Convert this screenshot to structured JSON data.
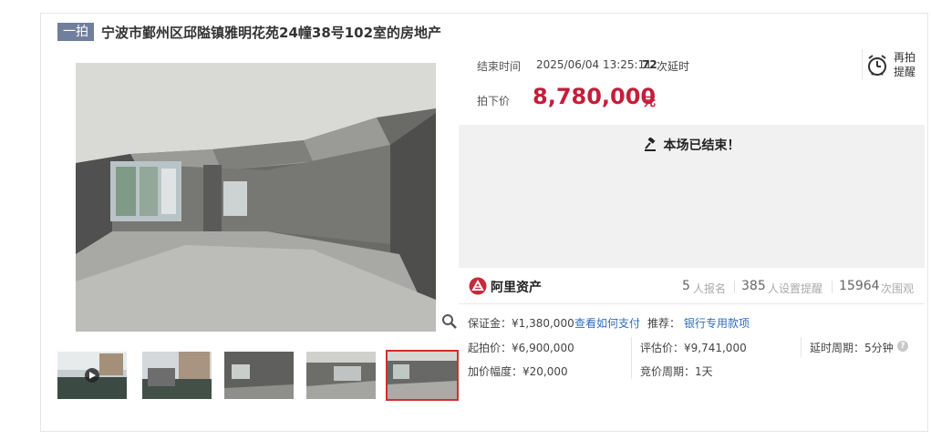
{
  "header": {
    "badge": "一拍",
    "title": "宁波市鄞州区邱隘镇雅明花苑24幢38号102室的房地产"
  },
  "auction": {
    "end_time_label": "结束时间",
    "end_time_value": "2025/06/04 13:25:11",
    "extend_count": "72",
    "extend_label": "次延时",
    "remind_line1": "再拍",
    "remind_line2": "提醒",
    "deal_price_label": "拍下价",
    "deal_price": "8,780,000",
    "currency": "元",
    "ended_text": "本场已结束！"
  },
  "platform": {
    "name": "阿里资产"
  },
  "stats": {
    "signups": "5",
    "signups_label": "人报名",
    "reminders": "385",
    "reminders_label": "人设置提醒",
    "views": "15964",
    "views_label": "次围观"
  },
  "details": {
    "deposit": "保证金：¥1,380,000",
    "pay_link": "查看如何支付",
    "recommend_label": "推荐：",
    "bank_link": "银行专用款项",
    "start_price": "起拍价：¥6,900,000",
    "eval_price": "评估价：¥9,741,000",
    "delay_period": "延时周期：5分钟",
    "increment": "加价幅度：¥20,000",
    "bid_period": "竞价周期：1天"
  },
  "icons": {
    "alarm": "alarm-clock-icon",
    "gavel": "gavel-icon",
    "zoom": "zoom-icon",
    "logo": "ali-asset-logo-icon",
    "help": "help-icon"
  },
  "colors": {
    "price": "#c41e3a",
    "link": "#2d6cc0",
    "badge": "#6f7f9c",
    "thumb_active_border": "#d0302c"
  }
}
